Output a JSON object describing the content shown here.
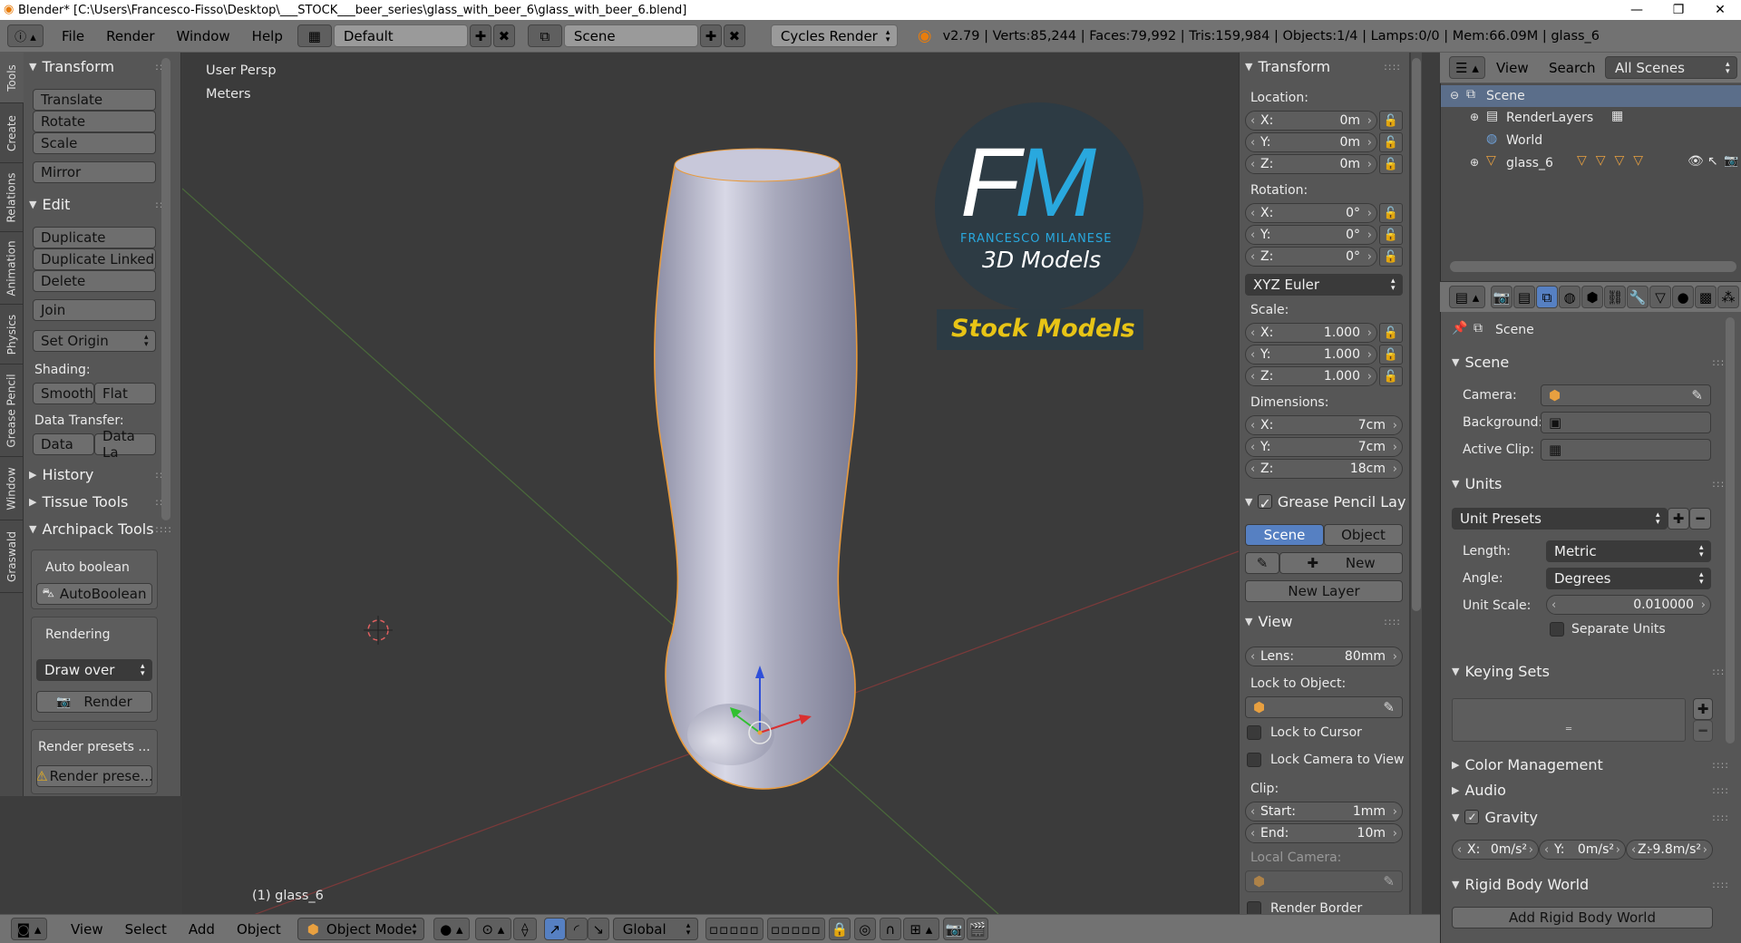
{
  "window": {
    "title": "Blender* [C:\\Users\\Francesco-Fisso\\Desktop\\___STOCK___beer_series\\glass_with_beer_6\\glass_with_beer_6.blend]",
    "minimize": "—",
    "maximize": "❐",
    "close": "✕"
  },
  "info_header": {
    "menus": [
      "File",
      "Render",
      "Window",
      "Help"
    ],
    "screen_layout": "Default",
    "scene": "Scene",
    "render_engine": "Cycles Render",
    "stats": "v2.79 | Verts:85,244 | Faces:79,992 | Tris:159,984 | Objects:1/4 | Lamps:0/0 | Mem:66.09M | glass_6"
  },
  "tool_tabs": [
    "Tools",
    "Create",
    "Relations",
    "Animation",
    "Physics",
    "Grease Pencil",
    "Window",
    "Graswald"
  ],
  "tool_shelf": {
    "transform": {
      "title": "Transform",
      "buttons": [
        "Translate",
        "Rotate",
        "Scale",
        "Mirror"
      ]
    },
    "edit": {
      "title": "Edit",
      "buttons": [
        "Duplicate",
        "Duplicate Linked",
        "Delete",
        "Join"
      ],
      "set_origin": "Set Origin",
      "shading_label": "Shading:",
      "smooth": "Smooth",
      "flat": "Flat",
      "data_transfer_label": "Data Transfer:",
      "data": "Data",
      "data_la": "Data La"
    },
    "history": "History",
    "tissue_tools": "Tissue Tools",
    "archipack": {
      "title": "Archipack Tools",
      "auto_boolean_label": "Auto boolean",
      "auto_boolean_btn": "AutoBoolean",
      "rendering_label": "Rendering",
      "draw_over": "Draw over",
      "render_btn": "Render",
      "render_presets_label": "Render presets ...",
      "render_presets_btn": "Render prese..."
    }
  },
  "viewport": {
    "view_name": "User Persp",
    "units": "Meters",
    "object_label": "(1) glass_6",
    "logo": {
      "initials_f": "F",
      "initials_m": "M",
      "name": "FRANCESCO MILANESE",
      "sub": "3D Models",
      "stock": "Stock Models"
    }
  },
  "n_panel": {
    "transform_title": "Transform",
    "location_label": "Location:",
    "location": [
      {
        "k": "X:",
        "v": "0m"
      },
      {
        "k": "Y:",
        "v": "0m"
      },
      {
        "k": "Z:",
        "v": "0m"
      }
    ],
    "rotation_label": "Rotation:",
    "rotation": [
      {
        "k": "X:",
        "v": "0°"
      },
      {
        "k": "Y:",
        "v": "0°"
      },
      {
        "k": "Z:",
        "v": "0°"
      }
    ],
    "rotation_mode": "XYZ Euler",
    "scale_label": "Scale:",
    "scale": [
      {
        "k": "X:",
        "v": "1.000"
      },
      {
        "k": "Y:",
        "v": "1.000"
      },
      {
        "k": "Z:",
        "v": "1.000"
      }
    ],
    "dimensions_label": "Dimensions:",
    "dimensions": [
      {
        "k": "X:",
        "v": "7cm"
      },
      {
        "k": "Y:",
        "v": "7cm"
      },
      {
        "k": "Z:",
        "v": "18cm"
      }
    ],
    "grease_pencil_title": "Grease Pencil Layer",
    "gp_scene": "Scene",
    "gp_object": "Object",
    "gp_new": "New",
    "gp_new_layer": "New Layer",
    "view_title": "View",
    "lens_label": "Lens:",
    "lens_value": "80mm",
    "lock_to_object": "Lock to Object:",
    "lock_to_cursor": "Lock to Cursor",
    "lock_camera": "Lock Camera to View",
    "clip_label": "Clip:",
    "clip_start_label": "Start:",
    "clip_start": "1mm",
    "clip_end_label": "End:",
    "clip_end": "10m",
    "local_camera": "Local Camera:",
    "render_border": "Render Border"
  },
  "outliner": {
    "view": "View",
    "search": "Search",
    "filter": "All Scenes",
    "items": [
      "Scene",
      "RenderLayers",
      "World",
      "glass_6"
    ]
  },
  "properties": {
    "context": "Scene",
    "scene_title": "Scene",
    "camera_label": "Camera:",
    "background_label": "Background:",
    "active_clip_label": "Active Clip:",
    "units_title": "Units",
    "unit_presets": "Unit Presets",
    "length_label": "Length:",
    "length_value": "Metric",
    "angle_label": "Angle:",
    "angle_value": "Degrees",
    "unit_scale_label": "Unit Scale:",
    "unit_scale_value": "0.010000",
    "separate_units": "Separate Units",
    "keying_sets_title": "Keying Sets",
    "color_management": "Color Management",
    "audio": "Audio",
    "gravity_title": "Gravity",
    "gravity": [
      {
        "k": "X:",
        "v": "0m/s²"
      },
      {
        "k": "Y:",
        "v": "0m/s²"
      },
      {
        "k": "Z:",
        "v": "-9.8m/s²"
      }
    ],
    "rigid_body_world": "Rigid Body World",
    "add_rigid_body_world": "Add Rigid Body World"
  },
  "bottom_header": {
    "menus": [
      "View",
      "Select",
      "Add",
      "Object"
    ],
    "mode": "Object Mode",
    "orientation": "Global"
  }
}
